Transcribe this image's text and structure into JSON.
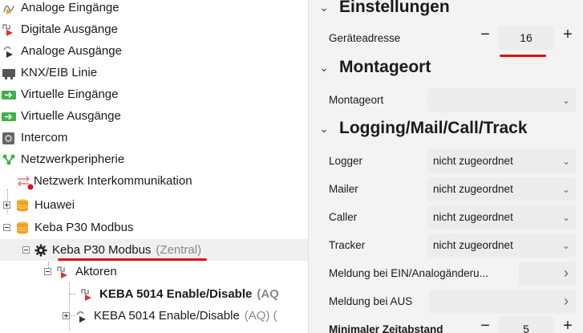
{
  "tree": {
    "items": [
      {
        "label": "Analoge Eingänge",
        "icon": "analog-input-icon"
      },
      {
        "label": "Digitale Ausgänge",
        "icon": "digital-output-icon"
      },
      {
        "label": "Analoge Ausgänge",
        "icon": "analog-output-icon"
      },
      {
        "label": "KNX/EIB Linie",
        "icon": "knx-line-icon"
      },
      {
        "label": "Virtuelle Eingänge",
        "icon": "virtual-input-icon"
      },
      {
        "label": "Virtuelle Ausgänge",
        "icon": "virtual-output-icon"
      },
      {
        "label": "Intercom",
        "icon": "intercom-icon"
      },
      {
        "label": "Netzwerkperipherie",
        "icon": "network-peripherals-icon"
      },
      {
        "label": "Netzwerk Interkommunikation",
        "icon": "network-intercom-icon"
      },
      {
        "label": "Huawei",
        "icon": "database-icon"
      },
      {
        "label": "Keba P30 Modbus",
        "icon": "database-icon"
      },
      {
        "label": "Keba P30 Modbus",
        "suffix": "(Zentral)",
        "icon": "gear-icon"
      },
      {
        "label": "Aktoren",
        "icon": "actuators-icon"
      },
      {
        "label": "KEBA 5014 Enable/Disable",
        "suffix": "(AQ",
        "icon": "actuator-output-icon"
      },
      {
        "label": "KEBA 5014 Enable/Disable",
        "suffix": "(AQ) (",
        "icon": "actuator-output-icon"
      }
    ]
  },
  "panel": {
    "sections": {
      "einstellungen": "Einstellungen",
      "montageort": "Montageort",
      "logging": "Logging/Mail/Call/Track"
    },
    "props": {
      "geraeteadresse_label": "Geräteadresse",
      "geraeteadresse_value": "16",
      "montageort_label": "Montageort",
      "montageort_value": "",
      "logger_label": "Logger",
      "logger_value": "nicht zugeordnet",
      "mailer_label": "Mailer",
      "mailer_value": "nicht zugeordnet",
      "caller_label": "Caller",
      "caller_value": "nicht zugeordnet",
      "tracker_label": "Tracker",
      "tracker_value": "nicht zugeordnet",
      "meldung_ein_label": "Meldung bei EIN/Analogänderu...",
      "meldung_aus_label": "Meldung bei AUS",
      "min_zeitabstand_label": "Minimaler Zeitabstand",
      "min_zeitabstand_value": "5"
    },
    "symbols": {
      "minus": "−",
      "plus": "+",
      "chevron_down": "⌄",
      "chevron_right": "›"
    }
  },
  "colors": {
    "annotation_red": "#d11111",
    "panel_bg": "#f3f3f3",
    "field_bg": "#ececec"
  }
}
